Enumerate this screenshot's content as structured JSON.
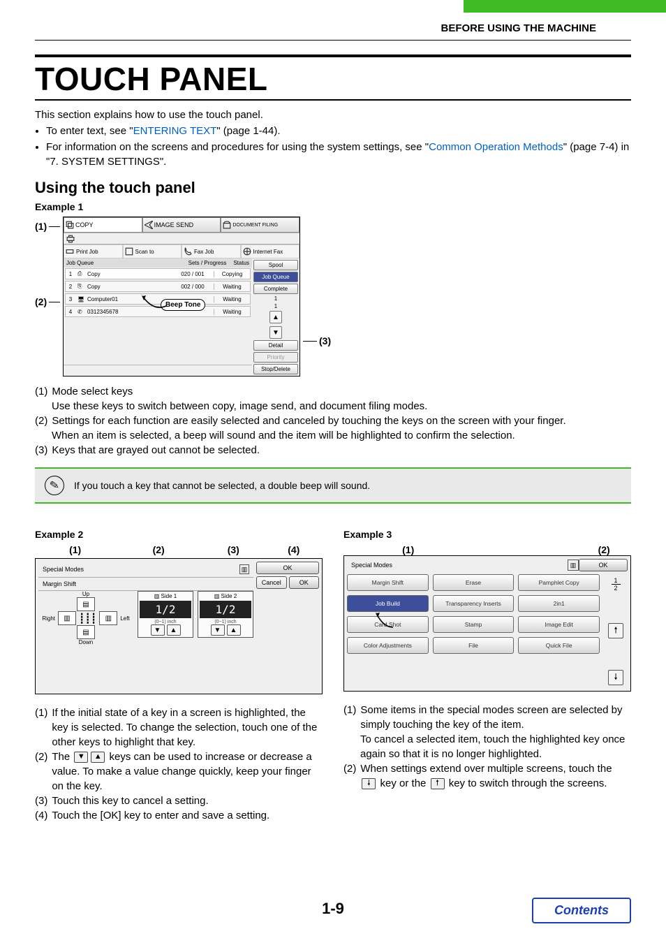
{
  "header": {
    "section": "BEFORE USING THE MACHINE"
  },
  "title": "TOUCH PANEL",
  "intro": {
    "line1": "This section explains how to use the touch panel.",
    "bullet1_a": "To enter text, see \"",
    "bullet1_link": "ENTERING TEXT",
    "bullet1_b": "\" (page 1-44).",
    "bullet2_a": "For information on the screens and procedures for using the system settings, see \"",
    "bullet2_link": "Common Operation Methods",
    "bullet2_b": "\" (page 7-4) in \"7. SYSTEM SETTINGS\"."
  },
  "subheading": "Using the touch panel",
  "example1": {
    "label": "Example 1",
    "callouts": {
      "c1": "(1)",
      "c2": "(2)",
      "c3": "(3)"
    },
    "mode_tabs": {
      "copy": "COPY",
      "image_send": "IMAGE SEND",
      "doc_filing": "DOCUMENT FILING"
    },
    "sub_tabs": {
      "print": "Print Job",
      "scan": "Scan to",
      "fax": "Fax Job",
      "ifax": "Internet Fax"
    },
    "headers": {
      "queue": "Job Queue",
      "sets": "Sets / Progress",
      "status": "Status"
    },
    "rows": [
      {
        "n": "1",
        "name": "Copy",
        "prog": "020 / 001",
        "status": "Copying"
      },
      {
        "n": "2",
        "name": "Copy",
        "prog": "002 / 000",
        "status": "Waiting"
      },
      {
        "n": "3",
        "name": "Computer01",
        "prog": "",
        "status": "Waiting"
      },
      {
        "n": "4",
        "name": "0312345678",
        "prog": "",
        "status": "Waiting"
      }
    ],
    "side": {
      "spool": "Spool",
      "jobqueue": "Job Queue",
      "complete": "Complete",
      "detail": "Detail",
      "priority": "Priority",
      "stopdel": "Stop/Delete",
      "one_a": "1",
      "one_b": "1"
    },
    "beep": "Beep Tone"
  },
  "descriptions1": [
    {
      "num": "(1)",
      "title": "Mode select keys",
      "body": "Use these keys to switch between copy, image send, and document filing modes."
    },
    {
      "num": "(2)",
      "title": "Settings for each function are easily selected and canceled by touching the keys on the screen with your finger.",
      "body": "When an item is selected, a beep will sound and the item will be highlighted to confirm the selection."
    },
    {
      "num": "(3)",
      "title": "Keys that are grayed out cannot be selected.",
      "body": ""
    }
  ],
  "note": "If you touch a key that cannot be selected, a double beep will sound.",
  "example2": {
    "label": "Example 2",
    "markers": {
      "m1": "(1)",
      "m2": "(2)",
      "m3": "(3)",
      "m4": "(4)"
    },
    "title": "Special Modes",
    "subtitle": "Margin Shift",
    "ok": "OK",
    "cancel": "Cancel",
    "ok2": "OK",
    "dirs": {
      "up": "Up",
      "down": "Down",
      "left": "Left",
      "right": "Right"
    },
    "side1": "Side 1",
    "side2": "Side 2",
    "val1": "1/2",
    "val2": "1/2",
    "range": "(0~1) inch",
    "desc": [
      {
        "num": "(1)",
        "text": "If the initial state of a key in a screen is highlighted, the key is selected. To change the selection, touch one of the other keys to highlight that key."
      },
      {
        "num": "(2)",
        "text_a": "The ",
        "text_b": " keys can be used to increase or decrease a value. To make a value change quickly, keep your finger on the key."
      },
      {
        "num": "(3)",
        "text": "Touch this key to cancel a setting."
      },
      {
        "num": "(4)",
        "text": "Touch the [OK] key to enter and save a setting."
      }
    ]
  },
  "example3": {
    "label": "Example 3",
    "markers": {
      "m1": "(1)",
      "m2": "(2)"
    },
    "title": "Special Modes",
    "ok": "OK",
    "page": {
      "cur": "1",
      "total": "2"
    },
    "buttons": [
      [
        "Margin Shift",
        "Erase",
        "Pamphlet Copy"
      ],
      [
        "Job Build",
        "Transparency Inserts",
        "2in1"
      ],
      [
        "Card Shot",
        "Stamp",
        "Image Edit"
      ],
      [
        "Color Adjustments",
        "File",
        "Quick File"
      ]
    ],
    "selected": "Job Build",
    "desc": [
      {
        "num": "(1)",
        "text": "Some items in the special modes screen are selected by simply touching the key of the item.",
        "text2": "To cancel a selected item, touch the highlighted key once again so that it is no longer highlighted."
      },
      {
        "num": "(2)",
        "text_a": "When settings extend over multiple screens, touch the ",
        "text_b": " key or the ",
        "text_c": " key to switch through the screens."
      }
    ]
  },
  "pagenum": "1-9",
  "contents": "Contents"
}
